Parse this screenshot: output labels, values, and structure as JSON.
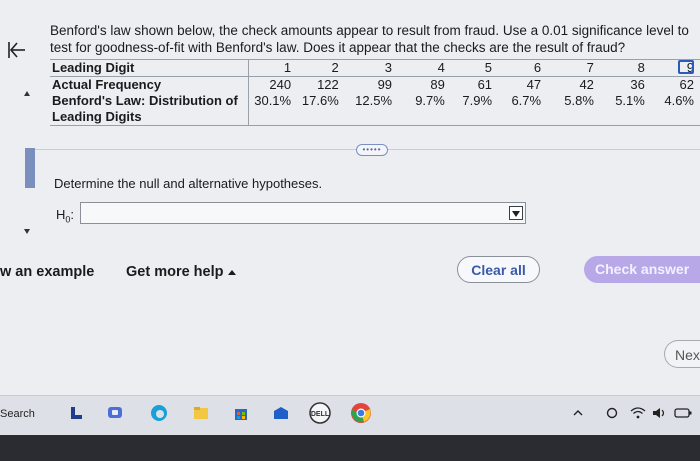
{
  "question": {
    "text": "Benford's law shown below, the check amounts appear to result from fraud. Use a 0.01 significance level to test for goodness-of-fit with Benford's law. Does it appear that the checks are the result of fraud?"
  },
  "table": {
    "row_labels": [
      "Leading Digit",
      "Actual Frequency",
      "Benford's Law: Distribution of",
      "Leading Digits"
    ],
    "digits": [
      "1",
      "2",
      "3",
      "4",
      "5",
      "6",
      "7",
      "8",
      "9"
    ],
    "frequencies": [
      "240",
      "122",
      "99",
      "89",
      "61",
      "47",
      "42",
      "36",
      "62"
    ],
    "distribution": [
      "30.1%",
      "17.6%",
      "12.5%",
      "9.7%",
      "7.9%",
      "6.7%",
      "5.8%",
      "5.1%",
      "4.6%"
    ]
  },
  "prompt": {
    "text": "Determine the null and alternative hypotheses."
  },
  "h0": {
    "label": "H",
    "subscript": "0",
    "colon": ":",
    "value": ""
  },
  "footer": {
    "example_label": "w an example",
    "help_label": "Get more help",
    "clear_label": "Clear all",
    "check_label": "Check answer",
    "next_label": "Nex"
  },
  "taskbar": {
    "search_label": "Search",
    "icons": [
      "l-app-icon",
      "chat-icon",
      "edge-icon",
      "file-explorer-icon",
      "store-icon",
      "mail-icon",
      "dell-icon",
      "chrome-icon"
    ],
    "tray_icons": [
      "chevron-up-icon",
      "onedrive-icon",
      "wifi-icon",
      "volume-icon",
      "battery-icon"
    ]
  },
  "colors": {
    "check_button": "#b8a8e8",
    "accent": "#3a59a8"
  }
}
